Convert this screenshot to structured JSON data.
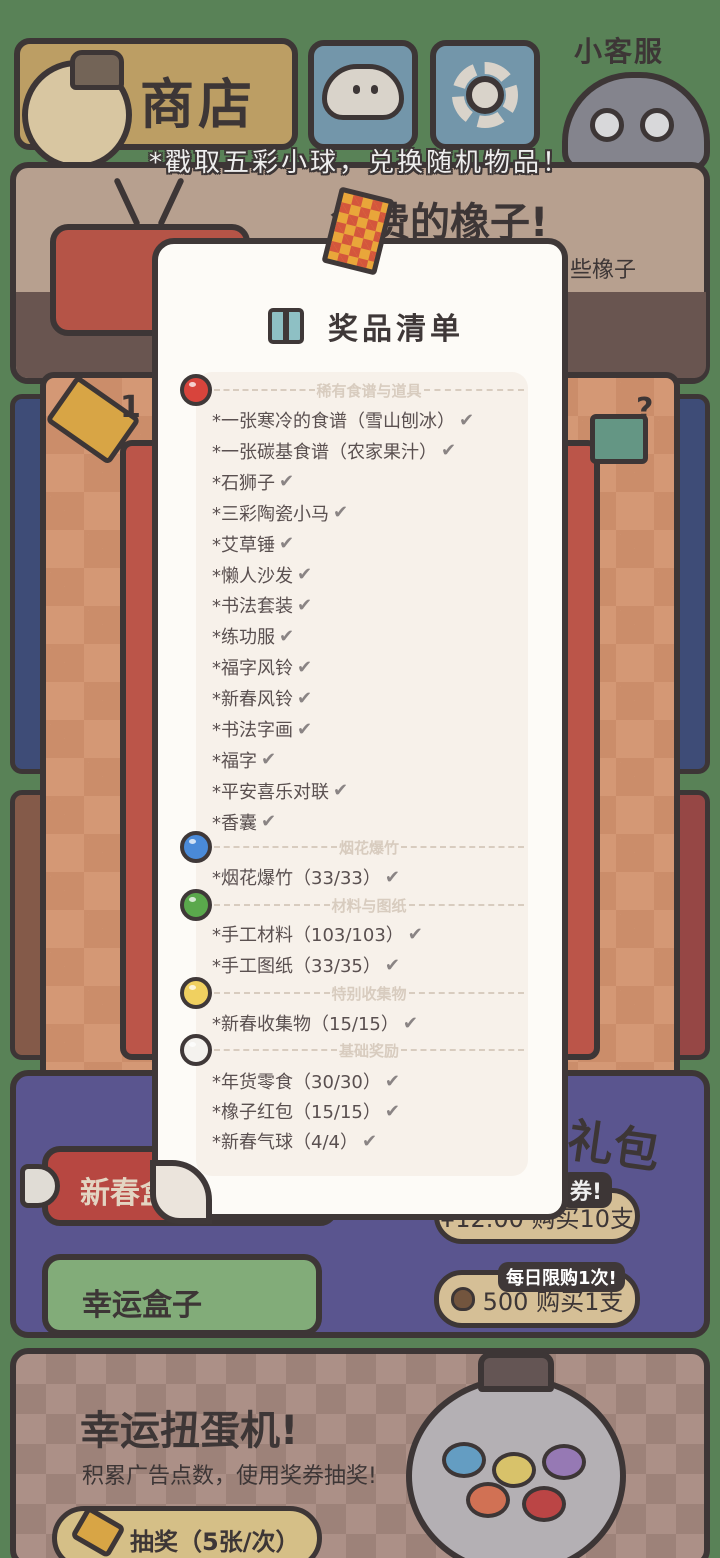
{
  "header": {
    "shop_label": "商店",
    "customer_service_label": "小客服"
  },
  "notice": "*戳取五彩小球，兑换随机物品！",
  "acorn_panel": {
    "title": "免费的橡子!",
    "subtitle": "些橡子"
  },
  "machine": {
    "ticket_count": "1"
  },
  "gift_panel": {
    "title": "礼包",
    "new_year_button": "新春盒",
    "lucky_box_button": "幸运盒子",
    "promo_tag": "券!",
    "buy10_label": "¥12.00 购买10支",
    "daily_tag": "每日限购1次!",
    "buy1_label": "500 购买1支"
  },
  "gacha_panel": {
    "title": "幸运扭蛋机!",
    "subtitle": "积累广告点数，使用奖券抽奖!",
    "draw_button": "抽奖（5张/次）"
  },
  "popup": {
    "title": "奖品清单",
    "check_glyph": "✔",
    "sections": [
      {
        "name": "稀有食谱与道具",
        "dot_color": "#d8443c",
        "items": [
          "*一张寒冷的食谱（雪山刨冰）",
          "*一张碳基食谱（农家果汁）",
          "*石狮子",
          "*三彩陶瓷小马",
          "*艾草锤",
          "*懒人沙发",
          "*书法套装",
          "*练功服",
          "*福字风铃",
          "*新春风铃",
          "*书法字画",
          "*福字",
          "*平安喜乐对联",
          "*香囊"
        ]
      },
      {
        "name": "烟花爆竹",
        "dot_color": "#4a8ad8",
        "items": [
          "*烟花爆竹（33/33）"
        ]
      },
      {
        "name": "材料与图纸",
        "dot_color": "#5aa84c",
        "items": [
          "*手工材料（103/103）",
          "*手工图纸（33/35）"
        ]
      },
      {
        "name": "特别收集物",
        "dot_color": "#f0d060",
        "items": [
          "*新春收集物（15/15）"
        ]
      },
      {
        "name": "基础奖励",
        "dot_color": "#f4f2ee",
        "items": [
          "*年货零食（30/30）",
          "*橡子红包（15/15）",
          "*新春气球（4/4）"
        ]
      }
    ]
  }
}
